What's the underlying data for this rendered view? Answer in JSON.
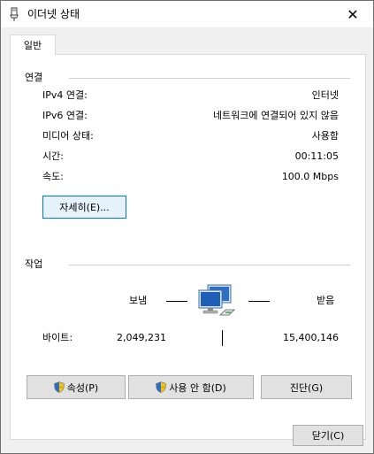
{
  "window": {
    "title": "이더넷 상태",
    "close_symbol": "✕"
  },
  "tabs": [
    {
      "label": "일반"
    }
  ],
  "connection": {
    "group_title": "연결",
    "rows": [
      {
        "label": "IPv4 연결:",
        "value": "인터넷"
      },
      {
        "label": "IPv6 연결:",
        "value": "네트워크에 연결되어 있지 않음"
      },
      {
        "label": "미디어 상태:",
        "value": "사용함"
      },
      {
        "label": "시간:",
        "value": "00:11:05"
      },
      {
        "label": "속도:",
        "value": "100.0 Mbps"
      }
    ],
    "details_button": "자세히(E)..."
  },
  "activity": {
    "group_title": "작업",
    "sent_label": "보냄",
    "received_label": "받음",
    "bytes_label": "바이트:",
    "bytes_sent": "2,049,231",
    "bytes_received": "15,400,146",
    "icon": "network-computers-icon"
  },
  "buttons": {
    "properties": "속성(P)",
    "disable": "사용 안 함(D)",
    "diagnose": "진단(G)",
    "close": "닫기(C)"
  },
  "colors": {
    "panel_bg": "#ffffff",
    "dialog_bg": "#f0f0f0",
    "focus_border": "#0078d7",
    "button_bg": "#e1e1e1"
  }
}
